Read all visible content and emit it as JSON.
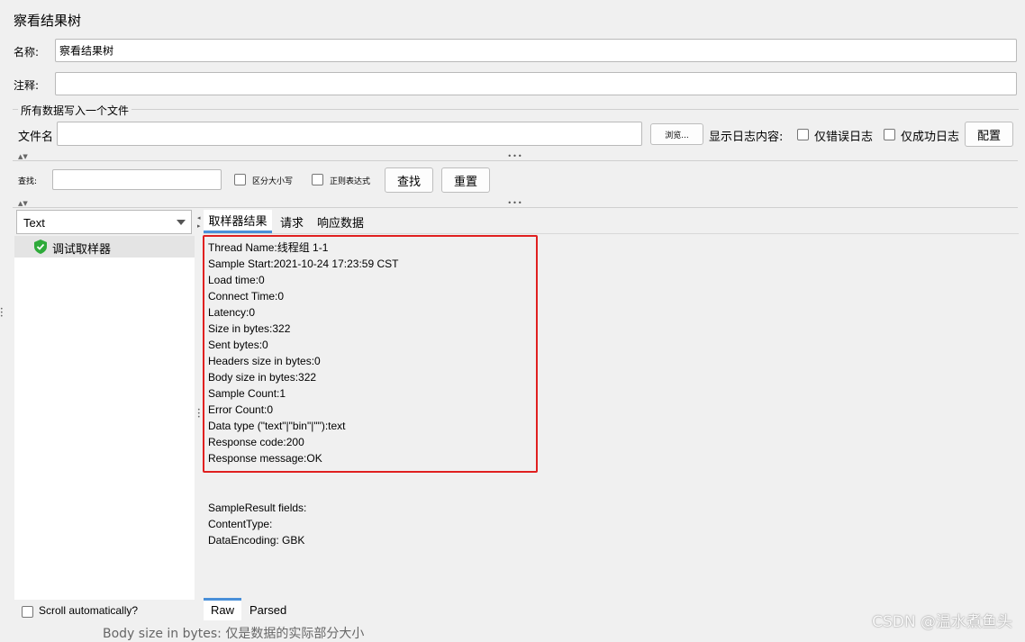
{
  "panel": {
    "title": "察看结果树"
  },
  "name_field": {
    "label": "名称:",
    "value": "察看结果树"
  },
  "comment_field": {
    "label": "注释:",
    "value": ""
  },
  "write_section": {
    "title": "所有数据写入一个文件",
    "filename_label": "文件名",
    "filename_value": "",
    "browse_label": "浏览...",
    "log_label": "显示日志内容:",
    "errors_only": "仅错误日志",
    "success_only": "仅成功日志",
    "configure_label": "配置"
  },
  "search": {
    "label": "查找:",
    "value": "",
    "case_sensitive": "区分大小写",
    "regex": "正则表达式",
    "find_button": "查找",
    "reset_button": "重置"
  },
  "renderer": {
    "selected": "Text"
  },
  "tree": {
    "items": [
      {
        "label": "调试取样器",
        "status": "success"
      }
    ]
  },
  "tabs": [
    {
      "label": "取样器结果",
      "active": true
    },
    {
      "label": "请求",
      "active": false
    },
    {
      "label": "响应数据",
      "active": false
    }
  ],
  "sampler_result": [
    "Thread Name:线程组 1-1",
    "Sample Start:2021-10-24 17:23:59 CST",
    "Load time:0",
    "Connect Time:0",
    "Latency:0",
    "Size in bytes:322",
    "Sent bytes:0",
    "Headers size in bytes:0",
    "Body size in bytes:322",
    "Sample Count:1",
    "Error Count:0",
    "Data type (\"text\"|\"bin\"|\"\"):text",
    "Response code:200",
    "Response message:OK"
  ],
  "sample_fields": [
    "SampleResult fields:",
    "ContentType:",
    "DataEncoding: GBK"
  ],
  "scroll_auto": "Scroll automatically?",
  "bottom_tabs": [
    {
      "label": "Raw",
      "active": true
    },
    {
      "label": "Parsed",
      "active": false
    }
  ],
  "overlay": {
    "bleed_text": "Body size in bytes: 仅是数据的实际部分大小",
    "watermark": "CSDN @温水煮鱼头"
  },
  "colors": {
    "highlight_border": "#e02020",
    "tab_underline": "#4a90d9",
    "success_icon": "#2eaa3a"
  }
}
